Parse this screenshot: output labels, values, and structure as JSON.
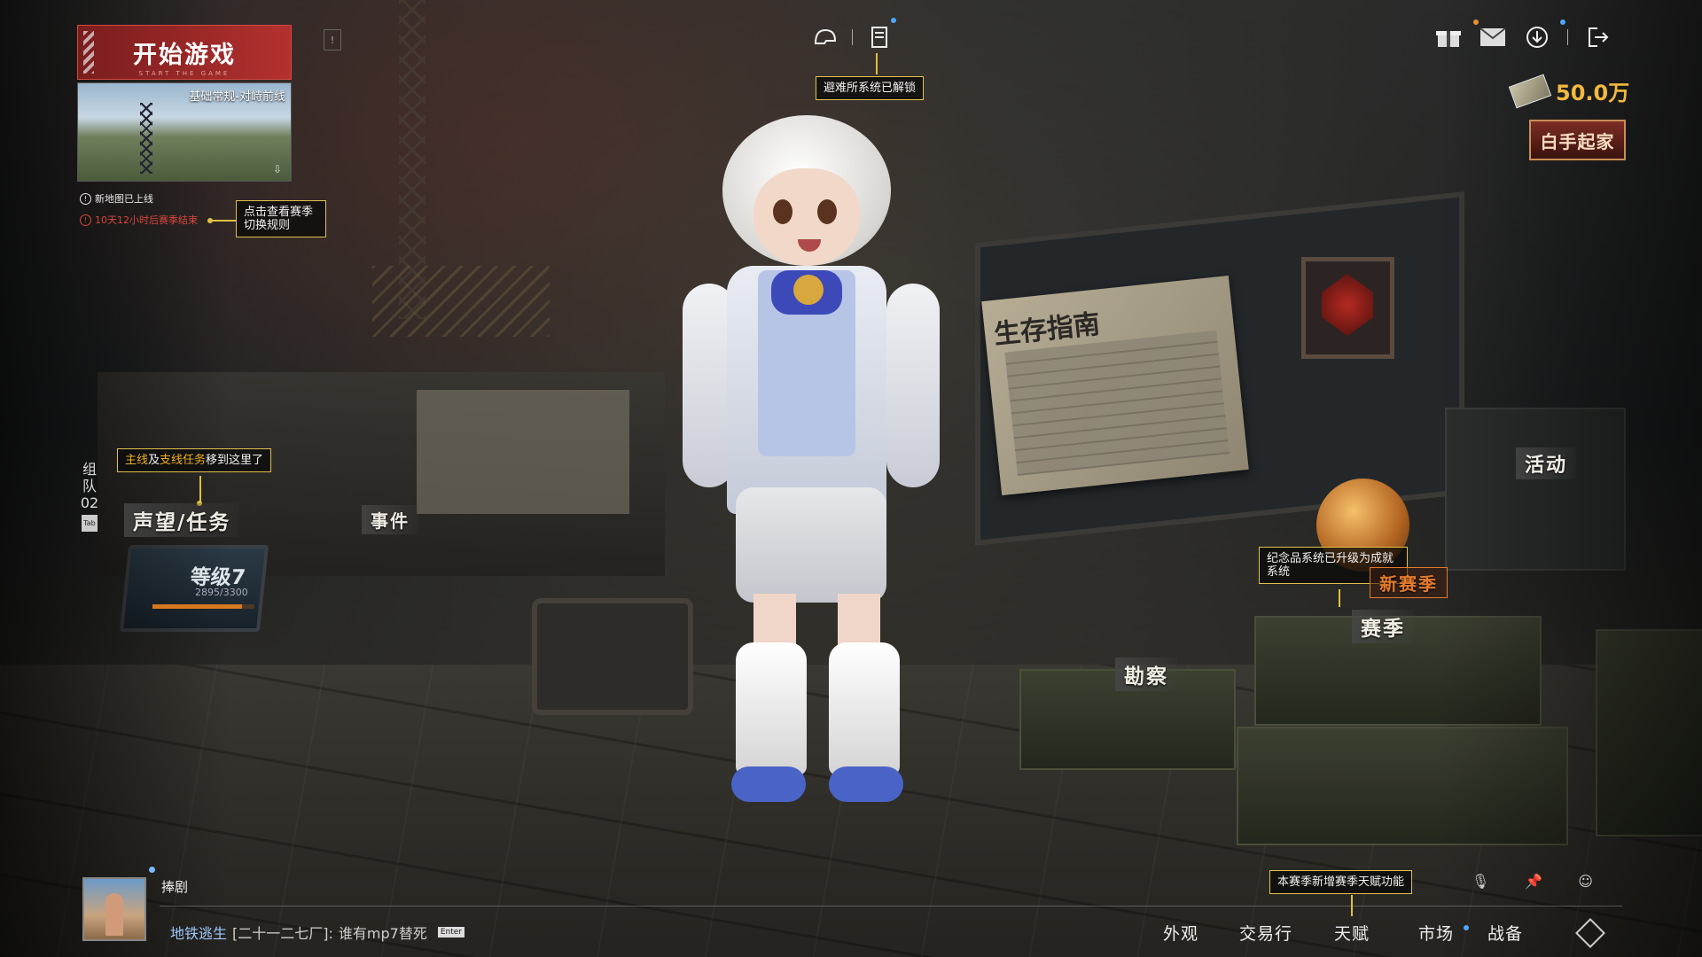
{
  "start_button": {
    "label": "开始游戏",
    "sub": "START THE GAME"
  },
  "map_card": {
    "mode": "基础常规-对峙前线"
  },
  "notices": {
    "new_map": "新地图已上线",
    "season_end": "10天12小时后赛季结束"
  },
  "tooltips": {
    "season_rules": "点击查看赛季切换规则",
    "shelter": "避难所系统已解锁",
    "quests": {
      "main": "主线",
      "and": "及",
      "side": "支线任务",
      "rest": "移到这里了"
    },
    "souvenir": "纪念品系统已升级为成就系统",
    "talent": "本赛季新增赛季天赋功能"
  },
  "scene_labels": {
    "reputation": "声望/任务",
    "events": "事件",
    "survival_guide": "生存指南",
    "activity": "活动",
    "new_season": "新赛季",
    "season": "赛季",
    "recon": "勘察"
  },
  "team": {
    "line1": "组",
    "line2": "队",
    "line3": "02",
    "tab": "Tab"
  },
  "level": {
    "title": "等级7",
    "xp": "2895/3300",
    "progress": 0.877
  },
  "currency": {
    "amount": "50.0万"
  },
  "badge": {
    "label": "白手起家"
  },
  "player": {
    "name": "捧剧"
  },
  "chat": {
    "channel": "地铁逃生",
    "room": "[二十一二七厂]:",
    "message": "谁有mp7替死",
    "enter": "Enter"
  },
  "bottom_nav": [
    "外观",
    "交易行",
    "天赋",
    "市场",
    "战备"
  ],
  "colors": {
    "accent": "#e0c040",
    "start": "#b3312f",
    "money": "#f2b840",
    "quest_highlight": "#f0b020"
  }
}
